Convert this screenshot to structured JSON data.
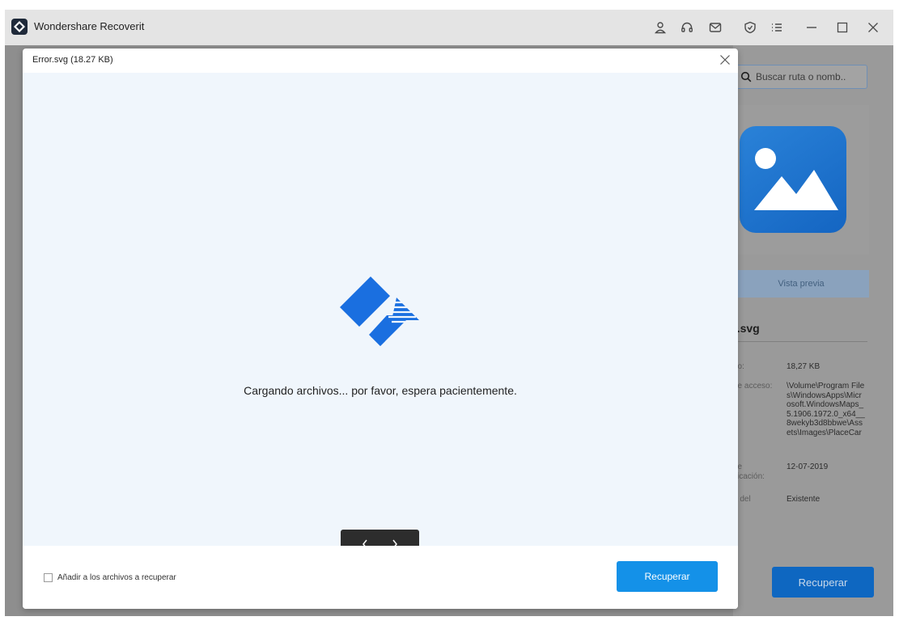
{
  "app": {
    "title": "Wondershare Recoverit",
    "toolbar_icons": [
      "user-icon",
      "headset-icon",
      "mail-icon",
      "shield-icon",
      "menu-icon",
      "minimize-icon",
      "maximize-icon",
      "close-icon"
    ]
  },
  "side_panel": {
    "search_placeholder": "Buscar ruta o nomb..",
    "preview_button": "Vista previa",
    "file_name": "r.svg",
    "info": [
      {
        "label": "ño:",
        "value": "18,27 KB"
      },
      {
        "label": "de acceso:",
        "value": "\\Volume\\Program Files\\WindowsApps\\Microsoft.WindowsMaps_5.1906.1972.0_x64__8wekyb3d8bbwe\\Assets\\Images\\PlaceCar"
      },
      {
        "label": "de\nificación:",
        "value": "12-07-2019"
      },
      {
        "label": "o del\nn",
        "value": "Existente"
      }
    ],
    "recover_button": "Recuperar"
  },
  "modal": {
    "title": "Error.svg (18.27 KB)",
    "loading_text": "Cargando archivos... por favor, espera pacientemente.",
    "add_to_recover_label": "Añadir a los archivos a recuperar",
    "recover_button": "Recuperar"
  },
  "colors": {
    "accent": "#1491e8",
    "logo_blue": "#1a6fe0",
    "overlay": "#8e8e8e"
  }
}
